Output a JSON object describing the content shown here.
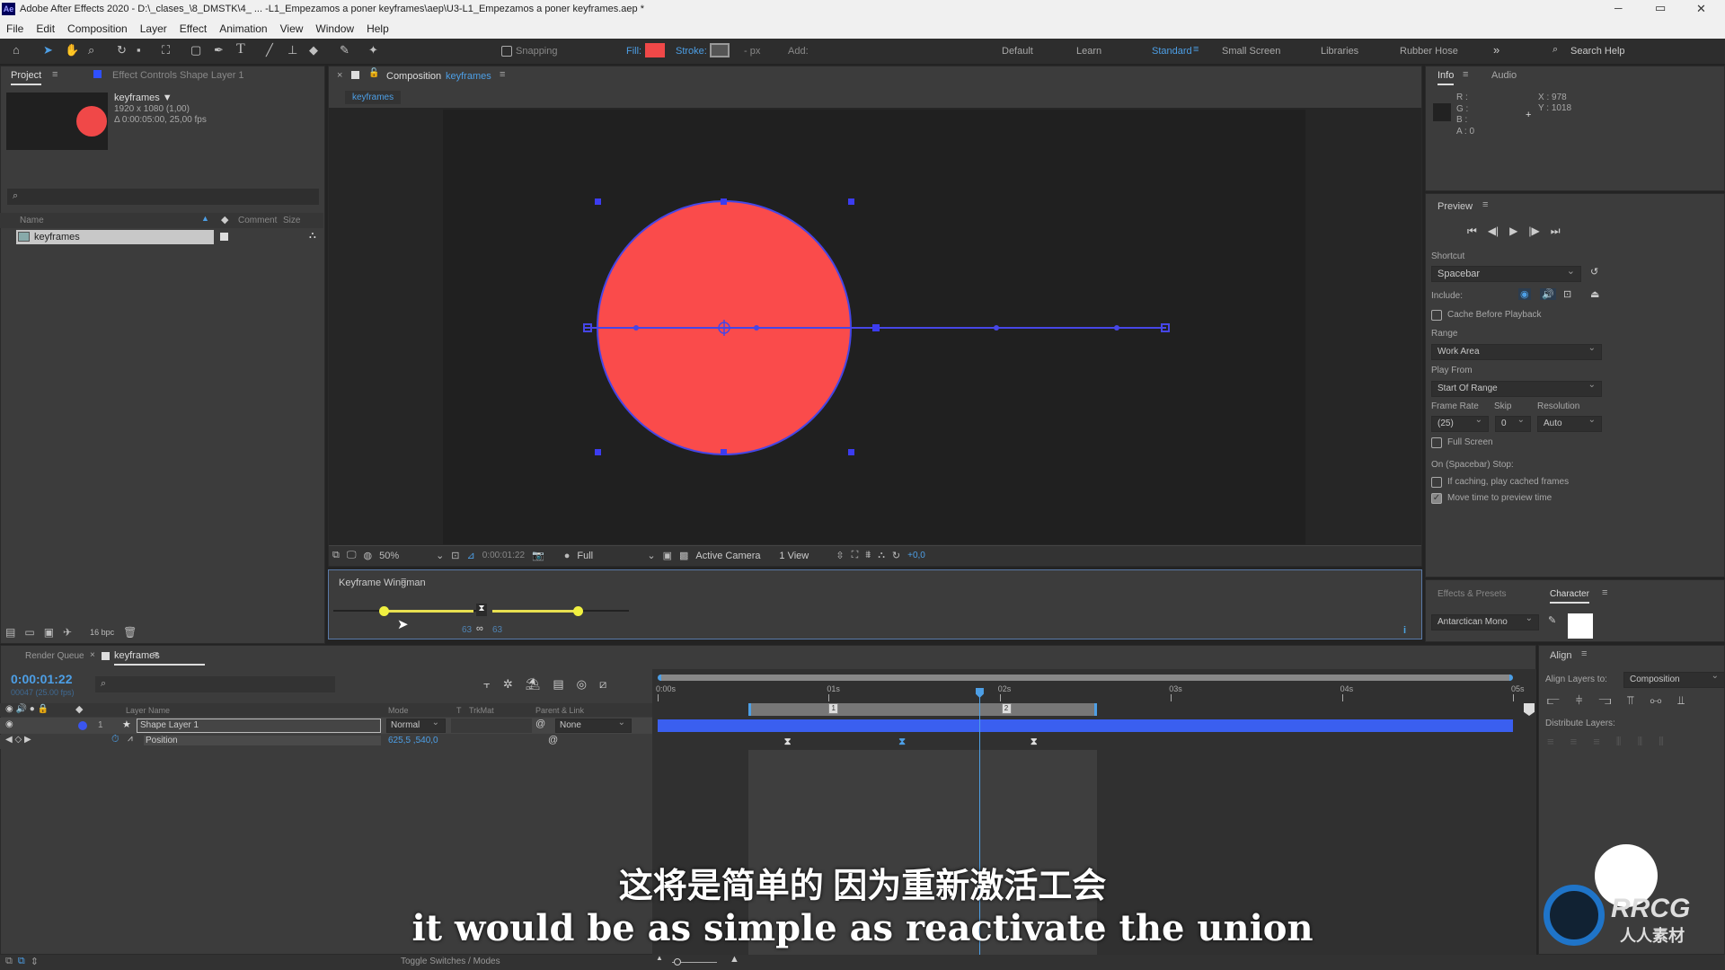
{
  "window": {
    "title": "Adobe After Effects 2020 - D:\\_clases_\\8_DMSTK\\4_ ... -L1_Empezamos a poner keyframes\\aep\\U3-L1_Empezamos a poner keyframes.aep *",
    "app_badge": "Ae",
    "minimize": "─",
    "maximize": "▭",
    "close": "✕"
  },
  "menu": [
    "File",
    "Edit",
    "Composition",
    "Layer",
    "Effect",
    "Animation",
    "View",
    "Window",
    "Help"
  ],
  "toolbar": {
    "snapping": "Snapping",
    "fill": "Fill:",
    "stroke": "Stroke:",
    "stroke_px": "- px",
    "add": "Add:",
    "fill_color": "#f04848",
    "workspaces": [
      "Default",
      "Learn",
      "Standard",
      "Small Screen",
      "Libraries",
      "Rubber Hose"
    ],
    "active_workspace": "Standard",
    "more": "»",
    "search_help": "Search Help"
  },
  "project": {
    "tab": "Project",
    "effect_controls": "Effect Controls Shape Layer 1",
    "item_name": "keyframes ▼",
    "item_dims": "1920 x 1080 (1,00)",
    "item_duration": "Δ 0:00:05:00, 25,00 fps",
    "columns": {
      "name": "Name",
      "comment": "Comment",
      "size": "Size"
    },
    "rows": [
      {
        "name": "keyframes"
      }
    ],
    "bpc": "16 bpc"
  },
  "composition": {
    "tab_label": "Composition",
    "tab_name": "keyframes",
    "subtab": "keyframes",
    "shape_color": "#fa4b4b",
    "path_color": "#4646e6"
  },
  "viewer": {
    "zoom": "50%",
    "timecode": "0:00:01:22",
    "resolution": "Full",
    "camera": "Active Camera",
    "views": "1 View",
    "exposure": "+0,0"
  },
  "wingman": {
    "title": "Keyframe Wingman",
    "influence_in": "63",
    "influence_out": "63",
    "info_icon": "i"
  },
  "info": {
    "tab": "Info",
    "audio_tab": "Audio",
    "r": "R :",
    "g": "G :",
    "b": "B :",
    "a": "A : 0",
    "x": "X : 978",
    "y": "Y : 1018"
  },
  "preview": {
    "title": "Preview",
    "shortcut_label": "Shortcut",
    "shortcut": "Spacebar",
    "include": "Include:",
    "cache": "Cache Before Playback",
    "range_label": "Range",
    "range": "Work Area",
    "play_from_label": "Play From",
    "play_from": "Start Of Range",
    "frame_rate_label": "Frame Rate",
    "frame_rate": "(25)",
    "skip_label": "Skip",
    "skip": "0",
    "resolution_label": "Resolution",
    "resolution": "Auto",
    "full_screen": "Full Screen",
    "stop_label": "On (Spacebar) Stop:",
    "if_caching": "If caching, play cached frames",
    "move_time": "Move time to preview time",
    "move_time_checked": true
  },
  "effects": {
    "tab": "Effects & Presets",
    "character_tab": "Character",
    "font": "Antarctican Mono"
  },
  "align": {
    "title": "Align",
    "align_to_label": "Align Layers to:",
    "align_to": "Composition",
    "distribute": "Distribute Layers:"
  },
  "timeline": {
    "render_queue": "Render Queue",
    "tab": "keyframes",
    "timecode": "0:00:01:22",
    "frames": "00047 (25.00 fps)",
    "columns": {
      "layer_name": "Layer Name",
      "mode": "Mode",
      "t": "T",
      "trkmat": "TrkMat",
      "parent": "Parent & Link"
    },
    "layer": {
      "index": "1",
      "name": "Shape Layer 1",
      "mode": "Normal",
      "parent": "None"
    },
    "property": {
      "name": "Position",
      "value": "625,5 ,540,0"
    },
    "ruler": [
      "0:00s",
      "01s",
      "02s",
      "03s",
      "04s",
      "05s"
    ],
    "current_time_s": 1.88,
    "work_area_s": [
      0.53,
      2.57
    ],
    "keyframes_s": [
      0.76,
      1.43,
      2.2
    ],
    "markers": [
      {
        "label": "1",
        "time_s": 1.02
      },
      {
        "label": "2",
        "time_s": 2.03
      }
    ],
    "toggle": "Toggle Switches / Modes"
  },
  "subtitles": {
    "zh": "这将是简单的 因为重新激活工会",
    "en": "it would be as simple as reactivate the union"
  },
  "watermark": {
    "logo": "RRCG",
    "logo_sub": "人人素材"
  }
}
